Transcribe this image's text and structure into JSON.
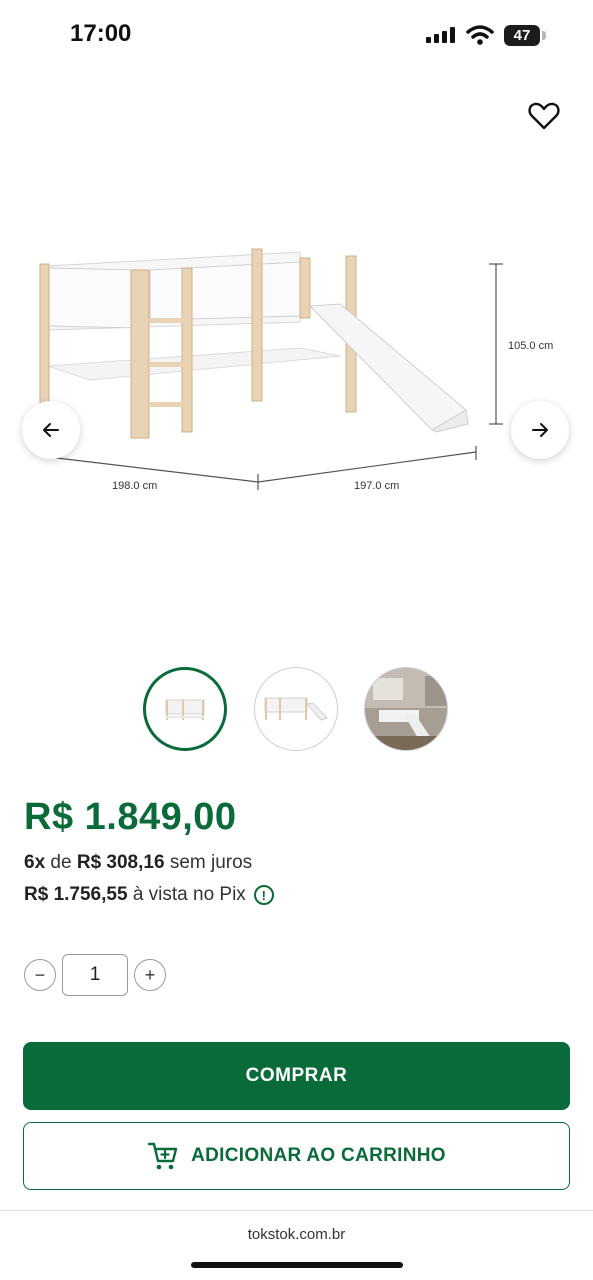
{
  "status_bar": {
    "time": "17:00",
    "battery": "47"
  },
  "product": {
    "dimensions": {
      "height": "105.0 cm",
      "depth": "198.0 cm",
      "width": "197.0 cm"
    },
    "price": "R$ 1.849,00",
    "installments": {
      "count": "6x",
      "word": "de",
      "amount": "R$ 308,16",
      "suffix": "sem juros"
    },
    "pix": {
      "amount": "R$ 1.756,55",
      "suffix": "à vista no Pix"
    }
  },
  "quantity": {
    "value": "1",
    "minus": "−",
    "plus": "+"
  },
  "actions": {
    "buy_label": "COMPRAR",
    "cart_label": "ADICIONAR AO CARRINHO"
  },
  "browser": {
    "url": "tokstok.com.br"
  },
  "icons": [
    "heart-icon",
    "arrow-left-icon",
    "arrow-right-icon",
    "info-icon",
    "cart-icon"
  ],
  "colors": {
    "brand_green": "#0a6b3a"
  }
}
